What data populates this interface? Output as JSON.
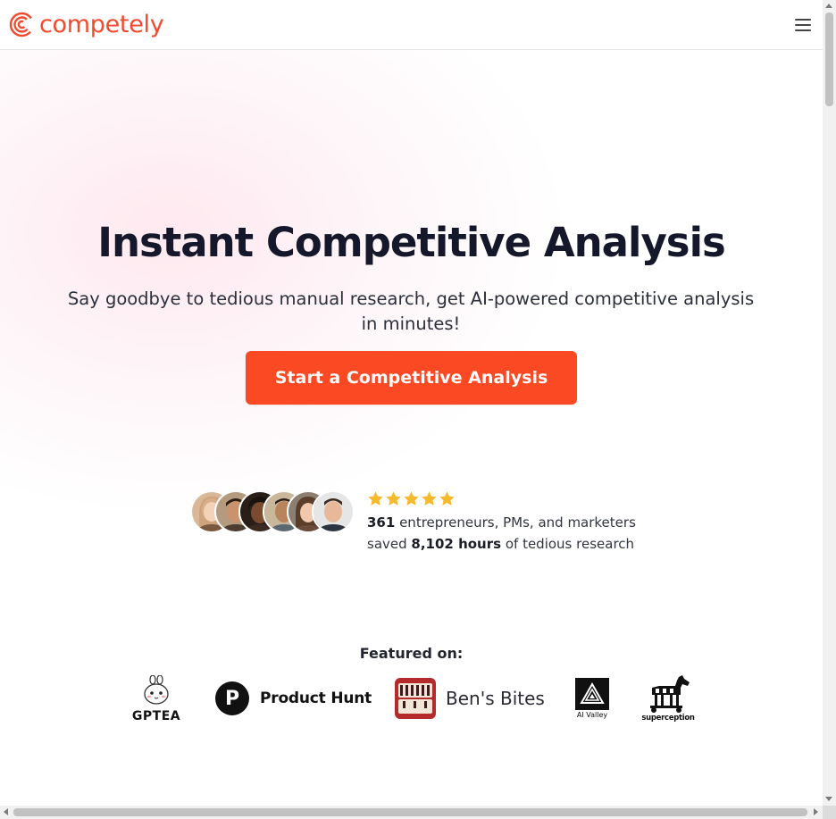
{
  "nav": {
    "brand": "competely",
    "menu_icon": "hamburger-menu-icon"
  },
  "hero": {
    "title": "Instant Competitive Analysis",
    "subtitle": "Say goodbye to tedious manual research, get AI-powered competitive analysis in minutes!",
    "cta_label": "Start a Competitive Analysis"
  },
  "social_proof": {
    "rating_stars": 5,
    "users_count": "361",
    "users_text": " entrepreneurs, PMs, and marketers",
    "saved_prefix": "saved ",
    "hours": "8,102 hours",
    "saved_suffix": " of tedious research"
  },
  "featured": {
    "title": "Featured on:",
    "logos": {
      "gptea": "GPTEA",
      "product_hunt": "Product Hunt",
      "product_hunt_letter": "P",
      "bens_bites": "Ben's Bites",
      "ai_valley": "AI Valley",
      "superception": "superception"
    }
  },
  "colors": {
    "brand": "#f14a2c",
    "cta": "#fb4a23",
    "star": "#f5b92e",
    "title": "#15182a"
  }
}
